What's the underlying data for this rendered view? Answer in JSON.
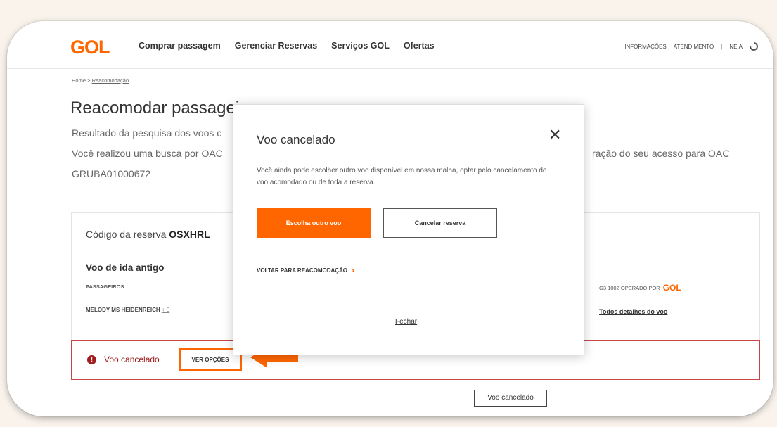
{
  "brand": {
    "logo": "GOL",
    "accent": "#ff6600",
    "alert_color": "#a11c1c"
  },
  "nav": {
    "links": [
      "Comprar passagem",
      "Gerenciar Reservas",
      "Serviços GOL",
      "Ofertas"
    ],
    "right": {
      "info": "INFORMAÇÕES",
      "support": "ATENDIMENTO",
      "separator": "|",
      "user": "NEIA"
    }
  },
  "breadcrumb": {
    "home": "Home",
    "sep": ">",
    "current": "Reacomodação"
  },
  "page": {
    "title": "Reacomodar passageiros",
    "desc1": "Resultado da pesquisa dos voos c",
    "desc2_left": "Você realizou uma busca por OAC",
    "desc2_right": "ração do seu acesso para OAC",
    "desc3": "GRUBA01000672"
  },
  "reservation": {
    "code_label": "Código da reserva",
    "code": "OSXHRL",
    "flight_title": "Voo de ida antigo",
    "passengers_header": "PASSAGEIROS",
    "passenger_name": "MELODY MS HEIDENREICH",
    "passenger_extra": "+ 0",
    "operated_text": "G3 1002 OPERADO POR",
    "operator_logo": "GOL",
    "details_link": "Todos detalhes do voo"
  },
  "alert": {
    "icon": "exclamation-icon",
    "text": "Voo cancelado",
    "button": "VER OPÇÕES"
  },
  "status_label": "Voo cancelado",
  "modal": {
    "title": "Voo cancelado",
    "close": "✕",
    "text": "Você ainda pode escolher outro voo disponível em nossa malha, optar pelo cancelamento do voo acomodado ou de toda a reserva.",
    "primary_button": "Escolha outro voo",
    "secondary_button": "Cancelar reserva",
    "back_link": "VOLTAR PARA REACOMODAÇÃO",
    "back_chevron": "›",
    "close_link": "Fechar"
  }
}
